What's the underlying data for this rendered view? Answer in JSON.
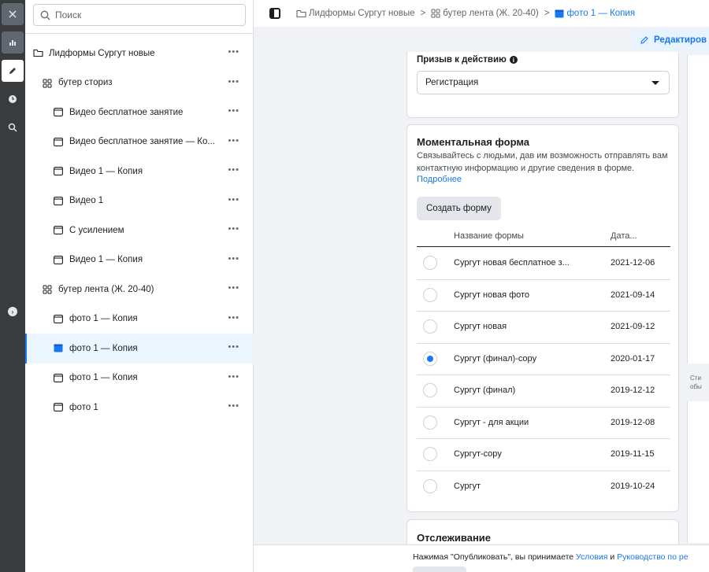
{
  "search": {
    "placeholder": "Поиск"
  },
  "tree": [
    {
      "label": "Лидформы Сургут новые",
      "level": 0,
      "icon": "folder-icon",
      "more": "•••"
    },
    {
      "label": "бутер сториз",
      "level": 1,
      "icon": "adset-icon",
      "more": "•••"
    },
    {
      "label": "Видео бесплатное занятие",
      "level": 2,
      "icon": "ad-icon",
      "more": "•••"
    },
    {
      "label": "Видео бесплатное занятие — Ко...",
      "level": 2,
      "icon": "ad-icon",
      "more": "•••"
    },
    {
      "label": "Видео 1 — Копия",
      "level": 2,
      "icon": "ad-icon",
      "more": "•••"
    },
    {
      "label": "Видео 1",
      "level": 2,
      "icon": "ad-icon",
      "more": "•••"
    },
    {
      "label": "С усилением",
      "level": 2,
      "icon": "ad-icon",
      "more": "•••"
    },
    {
      "label": "Видео 1 — Копия",
      "level": 2,
      "icon": "ad-icon",
      "more": "•••"
    },
    {
      "label": "бутер лента (Ж. 20-40)",
      "level": 1,
      "icon": "adset-icon",
      "more": "•••"
    },
    {
      "label": "фото 1 — Копия",
      "level": 2,
      "icon": "ad-icon",
      "more": "•••"
    },
    {
      "label": "фото 1 — Копия",
      "level": 2,
      "icon": "ad-icon",
      "more": "•••",
      "selected": true
    },
    {
      "label": "фото 1 — Копия",
      "level": 2,
      "icon": "ad-icon",
      "more": "•••"
    },
    {
      "label": "фото 1",
      "level": 2,
      "icon": "ad-icon",
      "more": "•••"
    }
  ],
  "breadcrumb": {
    "items": [
      "Лидформы Сургут новые",
      "бутер лента (Ж. 20-40)",
      "фото 1 — Копия"
    ],
    "separator": ">"
  },
  "toolbar": {
    "edit_label": "Редактиров"
  },
  "cta": {
    "label": "Призыв к действию",
    "info": "i",
    "selected": "Регистрация"
  },
  "instant_form": {
    "title": "Моментальная форма",
    "description": "Связывайтесь с людьми, дав им возможность отправлять вам контактную информацию и другие сведения в форме.",
    "link": "Подробнее",
    "create_label": "Создать форму",
    "columns": {
      "name": "Название формы",
      "date": "Дата..."
    },
    "rows": [
      {
        "name": "Сургут новая бесплатное з...",
        "date": "2021-12-06",
        "checked": false
      },
      {
        "name": "Сургут новая фото",
        "date": "2021-09-14",
        "checked": false
      },
      {
        "name": "Сургут новая",
        "date": "2021-09-12",
        "checked": false
      },
      {
        "name": "Сургут (финал)-copy",
        "date": "2020-01-17",
        "checked": true
      },
      {
        "name": "Сургут (финал)",
        "date": "2019-12-12",
        "checked": false
      },
      {
        "name": "Сургут - для акции",
        "date": "2019-12-08",
        "checked": false
      },
      {
        "name": "Сургут-copy",
        "date": "2019-11-15",
        "checked": false
      },
      {
        "name": "Сургут",
        "date": "2019-10-24",
        "checked": false
      }
    ]
  },
  "tracking": {
    "title": "Отслеживание"
  },
  "right_panel": {
    "note_line1": "Сти",
    "note_line2": "обы"
  },
  "footer": {
    "prefix": "Нажимая \"Опубликовать\", вы принимаете ",
    "link1": "Условия",
    "middle": " и ",
    "link2": "Руководство по ре"
  },
  "colors": {
    "accent": "#1877f2",
    "rail": "#3a3b3c",
    "selected_bg": "#ebf5ff"
  }
}
